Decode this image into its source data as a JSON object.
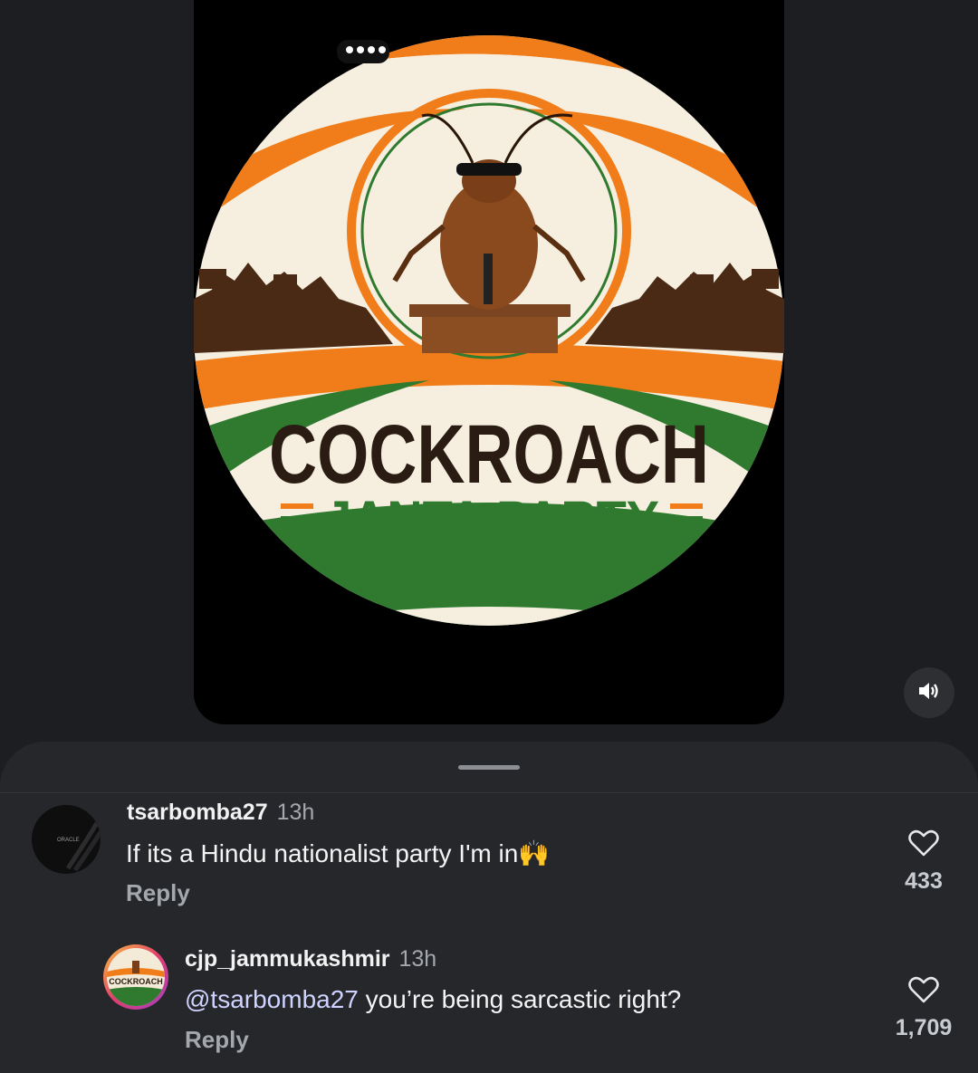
{
  "post": {
    "logo_title": "COCKROACH",
    "logo_subtitle": "JANTA PARTY",
    "mute_icon": "volume-icon"
  },
  "comments": [
    {
      "username": "tsarbomba27",
      "time": "13h",
      "text": "If its a Hindu nationalist party I'm in🙌",
      "reply_label": "Reply",
      "likes": "433",
      "avatar_text": "ORACLE"
    },
    {
      "username": "cjp_jammukashmir",
      "time": "13h",
      "mention": "@tsarbomba27",
      "text": " you’re being sarcastic right?",
      "reply_label": "Reply",
      "likes": "1,709",
      "avatar_text": "COCKROACH",
      "avatar_subtext": "JANTA PARTY"
    }
  ],
  "colors": {
    "saffron": "#f07d1a",
    "green": "#2f7a2f",
    "cream": "#f6efe0",
    "brown": "#4a2a14"
  }
}
